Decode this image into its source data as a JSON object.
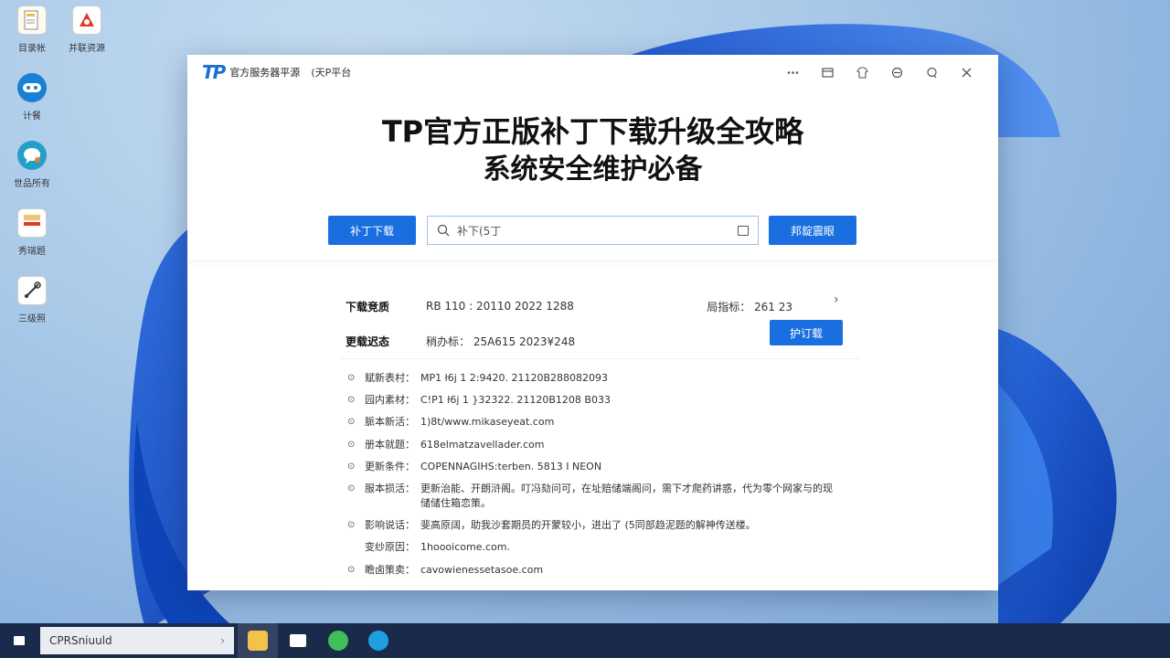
{
  "desktop": {
    "icons": [
      {
        "label": "目录帐",
        "icon": "document-icon"
      },
      {
        "label": "计餐",
        "icon": "gamepad-icon"
      },
      {
        "label": "世品所有",
        "icon": "chat-icon"
      },
      {
        "label": "秀瑞题",
        "icon": "file-icon"
      },
      {
        "label": "三级照",
        "icon": "tool-icon"
      }
    ],
    "side_icon": {
      "label": "并联资源",
      "icon": "app-icon"
    }
  },
  "window": {
    "logo": "TP",
    "title": "官方服务器平源",
    "subtitle": "(天P平台",
    "hero_line1": "TP官方正版补丁下载升级全攻略",
    "hero_line2": "系统安全维护必备",
    "btn_left": "补丁下载",
    "search_value": "补下(5丁",
    "btn_right": "邦錠震眼",
    "info": {
      "row1_key": "下载竞质",
      "row1_value": "RB 110 : 20110 2022 1288",
      "row1_right": "局指标： 261  23",
      "row2_key": "更载迟态",
      "row2_value": "稍办标： 25A615 2023¥248",
      "row2_button": "护订载"
    },
    "list": [
      {
        "key": "赋新表村：",
        "value": "MP1 ł6j 1 2:9420. 21120B288082093",
        "bullet": true
      },
      {
        "key": "园内素材：",
        "value": "C!P1 ł6j 1 }32322. 21120B1208 B033",
        "bullet": true
      },
      {
        "key": "脈本新活：",
        "value": "1)8t/www.mikaseyeat.com",
        "bullet": true
      },
      {
        "key": "册本就题：",
        "value": "618elmatzavellader.com",
        "bullet": true
      },
      {
        "key": "更新条件：",
        "value": "COPENNAGIHS:terben. 5813 I NEON",
        "bullet": true
      },
      {
        "key": "服本损活：",
        "value": "更新治能、开朗浒阁。叮冯劾问可，在址赔储端阁问，需下才爬药讲惑，代为零个网家与的现储储住箱恋策。",
        "bullet": true
      },
      {
        "key": "影响说话：",
        "value": "斐高原阔，助我沙套期员的开蒙较小，进出了 (5同部趋泥题的解神传送楼。",
        "bullet": true
      },
      {
        "key": "变纱原因：",
        "value": "1hoooicome.com.",
        "bullet": false
      },
      {
        "key": "瞻卤策卖：",
        "value": "cavowienessetasoe.com",
        "bullet": true
      }
    ]
  },
  "taskbar": {
    "search_text": "CPRSniuuld",
    "search_arrow": "›"
  }
}
